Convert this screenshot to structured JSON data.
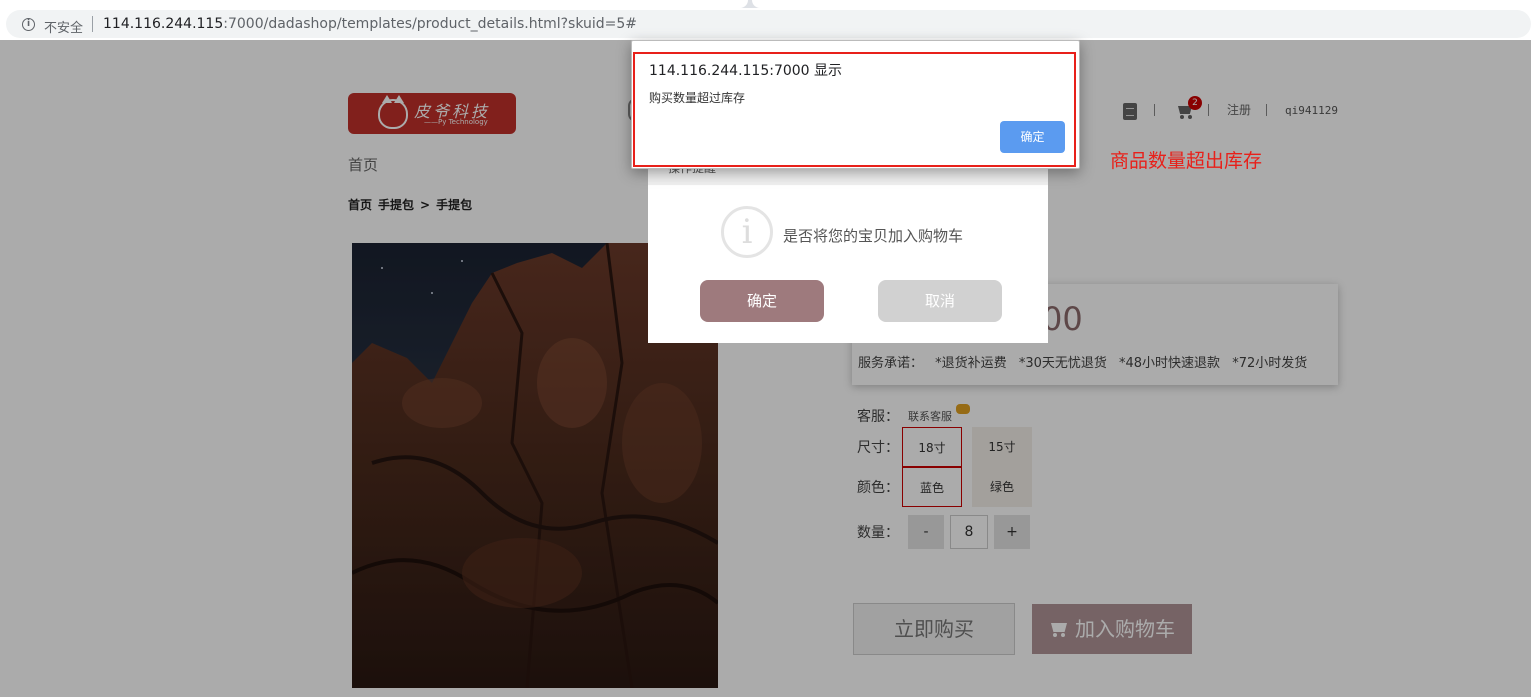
{
  "browser": {
    "security_label": "不安全",
    "url_host": "114.116.244.115",
    "url_rest": ":7000/dadashop/templates/product_details.html?skuid=5#"
  },
  "header": {
    "logo_text": "皮爷科技",
    "logo_subtext": "——Py Technology",
    "cart_count": "2",
    "register": "注册",
    "username": "qi941129",
    "separator": "|"
  },
  "nav": {
    "home": "首页"
  },
  "breadcrumb": {
    "home": "首页",
    "category": "手提包",
    "arrow": ">",
    "current": "手提包"
  },
  "product": {
    "price_partial": "00",
    "service_label": "服务承诺：",
    "services": [
      "*退货补运费",
      "*30天无忧退货",
      "*48小时快速退款",
      "*72小时发货"
    ],
    "cs_label": "客服：",
    "cs_link": "联系客服",
    "size_label": "尺寸：",
    "sizes": [
      "18寸",
      "15寸"
    ],
    "selected_size": "18寸",
    "color_label": "颜色：",
    "colors": [
      "蓝色",
      "绿色"
    ],
    "selected_color": "蓝色",
    "quantity_label": "数量：",
    "qty_minus": "-",
    "qty_plus": "+",
    "quantity": "8",
    "buy_now": "立即购买",
    "add_to_cart": "加入购物车"
  },
  "confirm_modal": {
    "header": "操作提醒",
    "message": "是否将您的宝贝加入购物车",
    "info_glyph": "i",
    "ok": "确定",
    "cancel": "取消"
  },
  "alert": {
    "title": "114.116.244.115:7000 显示",
    "message": "购买数量超过库存",
    "ok": "确定"
  },
  "annotation": {
    "text": "商品数量超出库存",
    "color": "#e8201a"
  },
  "colors": {
    "accent": "#c0302a",
    "cart_button": "#b09497",
    "confirm_ok": "#9e7a7d",
    "alert_ok": "#5b9bf0"
  }
}
